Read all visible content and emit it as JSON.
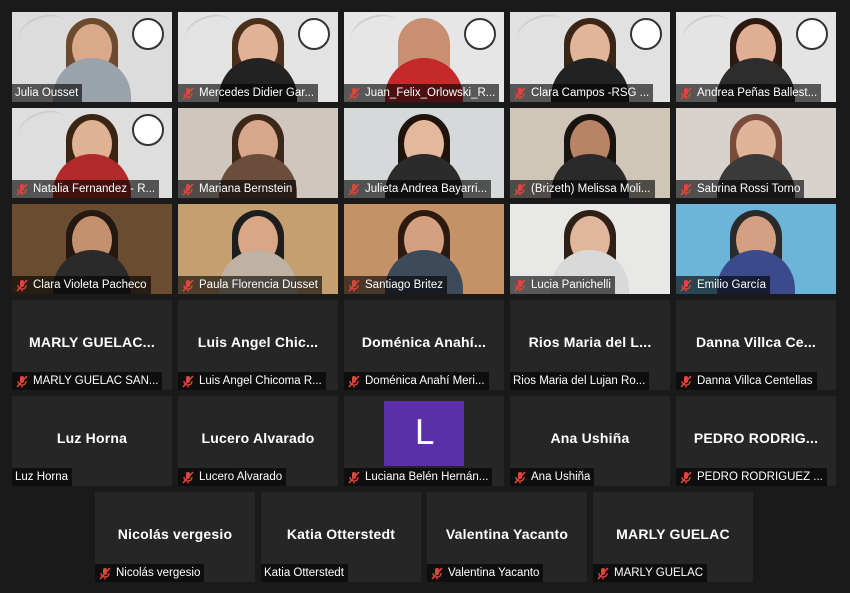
{
  "participants": [
    {
      "label": "Julia Ousset",
      "muted": false,
      "video": true,
      "active": true,
      "logo": true,
      "bg": "#dcdcdc",
      "skin": "#d9a98a",
      "hair": "#6b4a2e",
      "shirt": "#9aa3ab"
    },
    {
      "label": "Mercedes Didier Gar...",
      "muted": true,
      "video": true,
      "logo": true,
      "bg": "#e3e3e3",
      "skin": "#e2b296",
      "hair": "#4a2f1d",
      "shirt": "#222222"
    },
    {
      "label": "Juan_Felix_Orlowski_R...",
      "muted": true,
      "video": true,
      "logo": true,
      "bg": "#e6e6e6",
      "skin": "#c89070",
      "hair": "#c89070",
      "shirt": "#c42a2a"
    },
    {
      "label": "Clara Campos -RSG ...",
      "muted": true,
      "video": true,
      "logo": true,
      "bg": "#e1e1e1",
      "skin": "#e1b59a",
      "hair": "#3b2616",
      "shirt": "#222222"
    },
    {
      "label": "Andrea Peñas Ballest...",
      "muted": true,
      "video": true,
      "logo": true,
      "bg": "#e4e4e4",
      "skin": "#e0ae92",
      "hair": "#2a1a10",
      "shirt": "#2d2d2d"
    },
    {
      "label": "Natalia Fernandez - R...",
      "muted": true,
      "video": true,
      "logo": true,
      "bg": "#dedede",
      "skin": "#e0b294",
      "hair": "#3a2414",
      "shirt": "#b02a2a"
    },
    {
      "label": "Mariana Bernstein",
      "muted": true,
      "video": true,
      "bg": "#cfc7bd",
      "skin": "#d8a68a",
      "hair": "#3c281a",
      "shirt": "#6a4d3a"
    },
    {
      "label": "Julieta Andrea Bayarri...",
      "muted": true,
      "video": true,
      "bg": "#d6d9da",
      "skin": "#e4b89c",
      "hair": "#1f140c",
      "shirt": "#2b2b2b"
    },
    {
      "label": "(Brizeth) Melissa Moli...",
      "muted": true,
      "video": true,
      "bg": "#cfc6b8",
      "skin": "#b98466",
      "hair": "#1a1410",
      "shirt": "#2a2a2a"
    },
    {
      "label": "Sabrina Rossi Torno",
      "muted": true,
      "video": true,
      "bg": "#d8d2cc",
      "skin": "#e0b39a",
      "hair": "#7a4a3a",
      "shirt": "#3a3a3a"
    },
    {
      "label": "Clara Violeta Pacheco",
      "muted": true,
      "video": true,
      "bg": "#6a4d30",
      "skin": "#c4916f",
      "hair": "#241810",
      "shirt": "#2a2a2a"
    },
    {
      "label": "Paula Florencia Dusset",
      "muted": true,
      "video": true,
      "bg": "#c4a070",
      "skin": "#d9a686",
      "hair": "#1d1d1d",
      "shirt": "#bfb2a2"
    },
    {
      "label": "Santiago Britez",
      "muted": true,
      "video": true,
      "bg": "#c49266",
      "skin": "#d4a080",
      "hair": "#2a1a10",
      "shirt": "#3d4a5a"
    },
    {
      "label": "Lucia Panichelli",
      "muted": true,
      "video": true,
      "bg": "#e8e8e6",
      "skin": "#e0b69c",
      "hair": "#2e2016",
      "shirt": "#d9d9d9"
    },
    {
      "label": "Emilio García",
      "muted": true,
      "video": true,
      "bg": "#6cb4d8",
      "skin": "#d4a084",
      "hair": "#2a2a2a",
      "shirt": "#3a4a8a"
    },
    {
      "name": "MARLY GUELAC...",
      "label": "MARLY GUELAC SAN...",
      "muted": true
    },
    {
      "name": "Luis Angel Chic...",
      "label": "Luis Angel Chicoma R...",
      "muted": true
    },
    {
      "name": "Doménica Anahí...",
      "label": "Doménica Anahí Meri...",
      "muted": true
    },
    {
      "name": "Rios Maria del L...",
      "label": "Rios Maria del Lujan Ro...",
      "muted": false
    },
    {
      "name": "Danna Villca Ce...",
      "label": "Danna Villca Centellas",
      "muted": true
    },
    {
      "name": "Luz Horna",
      "label": "Luz Horna",
      "muted": false
    },
    {
      "name": "Lucero Alvarado",
      "label": "Lucero Alvarado",
      "muted": true
    },
    {
      "avatar": "L",
      "label": "Luciana Belén Hernán...",
      "muted": true
    },
    {
      "name": "Ana Ushiña",
      "label": "Ana Ushiña",
      "muted": true
    },
    {
      "name": "PEDRO RODRIG...",
      "label": "PEDRO RODRIGUEZ ...",
      "muted": true
    },
    {
      "name": "Nicolás vergesio",
      "label": "Nicolás vergesio",
      "muted": true
    },
    {
      "name": "Katia Otterstedt",
      "label": "Katia Otterstedt",
      "muted": false
    },
    {
      "name": "Valentina Yacanto",
      "label": "Valentina Yacanto",
      "muted": true
    },
    {
      "name": "MARLY GUELAC",
      "label": "MARLY GUELAC",
      "muted": true
    }
  ],
  "colors": {
    "active_border": "#d8e86a",
    "mute_icon": "#e0463c",
    "avatar_bg": "#5b2fa8",
    "tile_bg": "#262626",
    "page_bg": "#1a1a1a"
  },
  "icons": {
    "mute": "microphone-off-icon"
  }
}
